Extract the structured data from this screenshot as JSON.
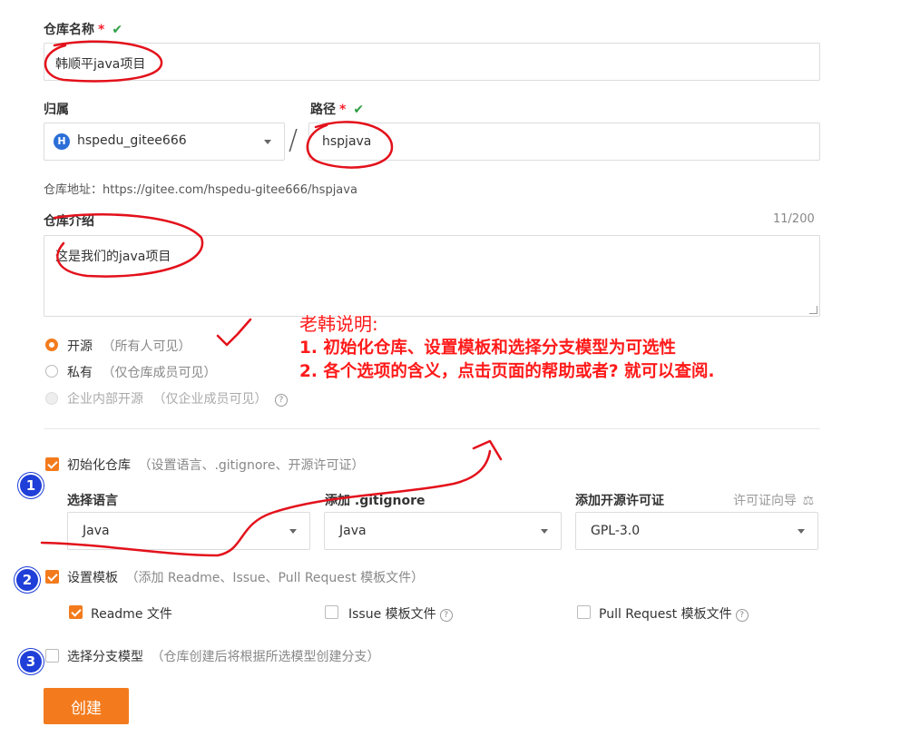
{
  "form": {
    "repo_name_label": "仓库名称",
    "required_mark": "*",
    "valid_mark": "✔",
    "repo_name_value": "韩顺平java项目",
    "owner_label": "归属",
    "owner_avatar_letter": "H",
    "owner_value": "hspedu_gitee666",
    "path_separator": "/",
    "path_label": "路径",
    "path_value": "hspjava",
    "repo_url_text": "仓库地址：https://gitee.com/hspedu-gitee666/hspjava",
    "intro_label": "仓库介绍",
    "intro_counter": "11/200",
    "intro_value": "这是我们的java项目"
  },
  "visibility": [
    {
      "label": "开源",
      "hint": "（所有人可见）",
      "state": "selected"
    },
    {
      "label": "私有",
      "hint": "（仅仓库成员可见）",
      "state": "unselected"
    },
    {
      "label": "企业内部开源",
      "hint": "（仅企业成员可见）",
      "state": "disabled"
    }
  ],
  "init_repo": {
    "label": "初始化仓库",
    "hint": "（设置语言、.gitignore、开源许可证）",
    "checked": true,
    "language_label": "选择语言",
    "language_value": "Java",
    "gitignore_label": "添加 .gitignore",
    "gitignore_value": "Java",
    "license_label": "添加开源许可证",
    "license_guide": "许可证向导",
    "license_value": "GPL-3.0"
  },
  "template": {
    "label": "设置模板",
    "hint": "（添加 Readme、Issue、Pull Request 模板文件）",
    "checked": true,
    "readme_label": "Readme 文件",
    "issue_label": "Issue 模板文件",
    "pr_label": "Pull Request 模板文件"
  },
  "branch_model": {
    "label": "选择分支模型",
    "hint": "（仓库创建后将根据所选模型创建分支）",
    "checked": false
  },
  "create_label": "创建",
  "help_glyph": "?",
  "annotation": {
    "title": "老韩说明:",
    "line1": "1. 初始化仓库、设置模板和选择分支模型为可选性",
    "line2": "2. 各个选项的含义，点击页面的帮助或者? 就可以查阅."
  },
  "badges": [
    "1",
    "2",
    "3"
  ],
  "colors": {
    "accent": "#f37b1d",
    "annotation": "#ff1a1a",
    "badge": "#1f3fd8",
    "valid": "#2e9e44"
  }
}
